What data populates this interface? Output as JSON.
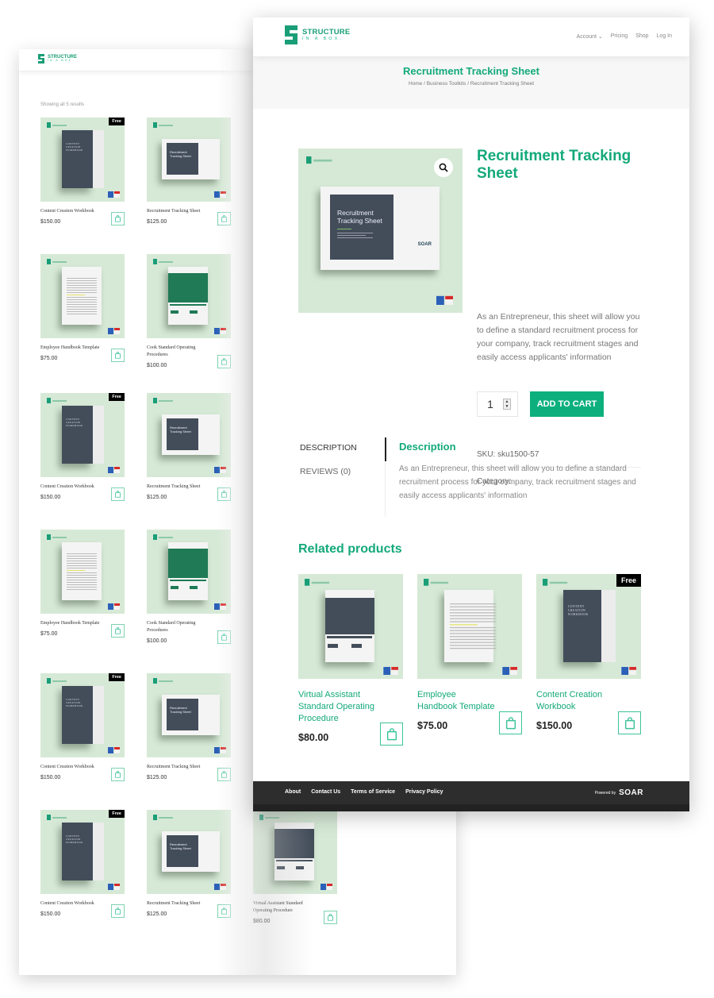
{
  "back_page": {
    "logo": {
      "main": "STRUCTURE",
      "sub": "IN A BOX."
    },
    "results_text": "Showing all 5 results",
    "products": [
      {
        "name": "Content Creation Workbook",
        "price": "$150.00",
        "badge": "Free",
        "kind": "book"
      },
      {
        "name": "Recruitment Tracking Sheet",
        "price": "$125.00",
        "badge": null,
        "kind": "landscape"
      },
      {
        "name": "Employee Handbook Template",
        "price": "$75.00",
        "badge": null,
        "kind": "portrait"
      },
      {
        "name": "Cook Standard Operating Procedures",
        "price": "$100.00",
        "badge": null,
        "kind": "sop-green"
      },
      {
        "name": "Content Creation Workbook",
        "price": "$150.00",
        "badge": "Free",
        "kind": "book"
      },
      {
        "name": "Recruitment Tracking Sheet",
        "price": "$125.00",
        "badge": null,
        "kind": "landscape"
      },
      {
        "name": "Employee Handbook Template",
        "price": "$75.00",
        "badge": null,
        "kind": "portrait"
      },
      {
        "name": "Cook Standard Operating Procedures",
        "price": "$100.00",
        "badge": null,
        "kind": "sop-green"
      },
      {
        "name": "Content Creation Workbook",
        "price": "$150.00",
        "badge": "Free",
        "kind": "book"
      },
      {
        "name": "Recruitment Tracking Sheet",
        "price": "$125.00",
        "badge": null,
        "kind": "landscape"
      },
      {
        "name": "Content Creation Workbook",
        "price": "$150.00",
        "badge": "Free",
        "kind": "book"
      },
      {
        "name": "Recruitment Tracking Sheet",
        "price": "$125.00",
        "badge": null,
        "kind": "landscape"
      },
      {
        "name": "Virtual Assistant Standard Operating Procedure",
        "price": "$80.00",
        "badge": null,
        "kind": "sop-dark"
      }
    ]
  },
  "front_page": {
    "logo": {
      "main": "STRUCTURE",
      "sub": "IN A BOX."
    },
    "nav": {
      "account": "Account",
      "pricing": "Pricing",
      "shop": "Shop",
      "login": "Log In"
    },
    "page_title": "Recruitment Tracking Sheet",
    "breadcrumb": "Home / Business Toolkits / Recruitment Tracking Sheet",
    "product": {
      "title": "Recruitment Tracking Sheet",
      "image_title": "Recruitment Tracking Sheet",
      "image_brand": "SOAR",
      "short_description": "As an Entrepreneur, this sheet will allow you to define a standard recruitment process for your company, track recruitment stages and easily access applicants' information",
      "quantity": "1",
      "add_to_cart": "ADD TO CART",
      "sku_label": "SKU:",
      "sku": "sku1500-57",
      "category_label": "Category:"
    },
    "tabs": [
      {
        "label": "DESCRIPTION",
        "active": true
      },
      {
        "label": "REVIEWS (0)",
        "active": false
      }
    ],
    "description": {
      "heading": "Description",
      "body": "As an Entrepreneur, this sheet will allow you to define a standard recruitment process for your company, track recruitment stages and easily access applicants' information"
    },
    "related": {
      "heading": "Related products",
      "items": [
        {
          "name": "Virtual Assistant Standard Operating Procedure",
          "price": "$80.00",
          "badge": null
        },
        {
          "name": "Employee Handbook Template",
          "price": "$75.00",
          "badge": null
        },
        {
          "name": "Content Creation Workbook",
          "price": "$150.00",
          "badge": "Free"
        }
      ]
    },
    "footer": {
      "links": [
        "About",
        "Contact Us",
        "Terms of Service",
        "Privacy Policy"
      ],
      "powered_by": "Powered by",
      "brand": "SOAR"
    }
  },
  "colors": {
    "brand_green": "#13a97a",
    "button_green": "#0db07d",
    "thumb_bg": "#d6e9d6",
    "footer_bg": "#2d2d2d"
  }
}
